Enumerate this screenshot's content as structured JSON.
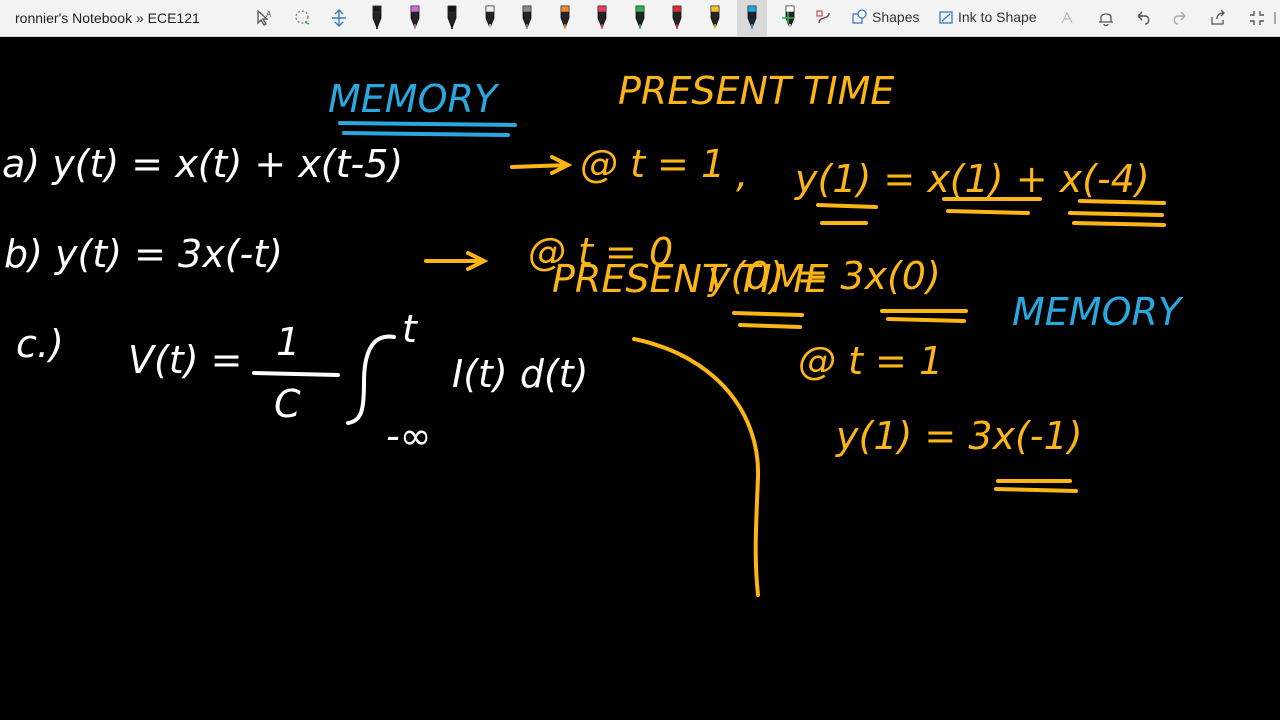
{
  "window": {
    "title": "ronnier's Notebook » ECE121"
  },
  "toolbar": {
    "shapes_label": "Shapes",
    "ink_to_shape_label": "Ink to Shape",
    "pen_colors": [
      "#1a1a1a",
      "#d06bd6",
      "#111111",
      "#eeeeee",
      "#888888",
      "#f58a2c",
      "#f0385a",
      "#2ab34a",
      "#e0282e",
      "#f5c623",
      "#19a9e6",
      "#ffffff"
    ]
  },
  "canvas": {
    "ink_white": "#ffffff",
    "ink_orange": "#fbb515",
    "ink_blue": "#29a8e0",
    "labels": {
      "memory_1": "MEMORY",
      "present_time_1": "PRESENT TIME",
      "eq_a": "a) y(t) = x(t) + x(t-5)",
      "at_t1": "@ t = 1",
      "comma": ",",
      "a_result": "y(1) = x(1) + x(-4)",
      "eq_b": "b)  y(t) = 3x(-t)",
      "at_t0": "@ t = 0",
      "present_time_2": "PRESENT TIME",
      "b_result_1": "y(0) = 3x(0)",
      "memory_2": "MEMORY",
      "at_t1_b": "@ t = 1",
      "b_result_2": "y(1) = 3x(-1)",
      "c_label": "c.)",
      "c_lhs": "V(t) =",
      "c_num": "1",
      "c_den": "C",
      "c_upper": "t",
      "c_lower": "-∞",
      "c_integrand": "I(t) d(t)"
    }
  }
}
